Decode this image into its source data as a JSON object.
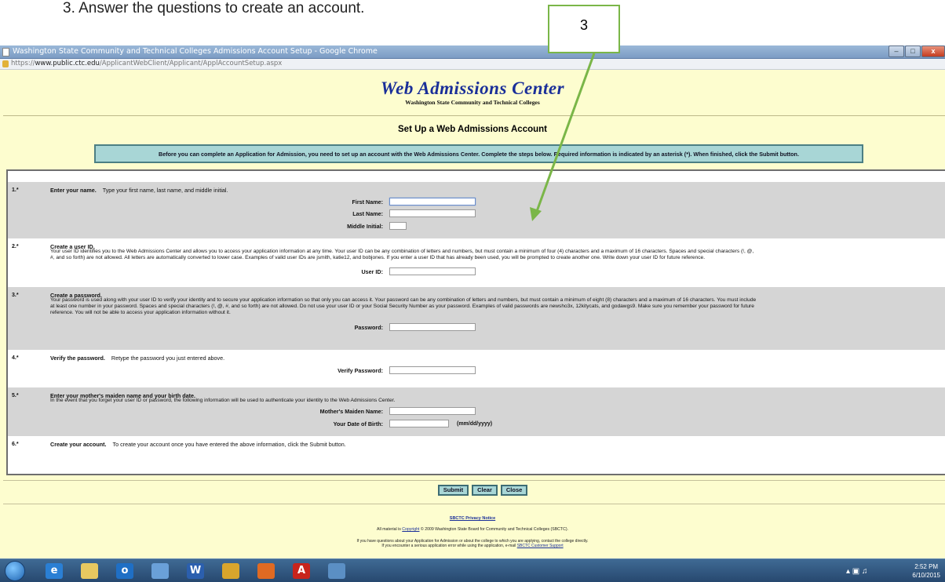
{
  "document": {
    "step_text": "3.   Answer the questions to create an account.",
    "callout": "3"
  },
  "browser": {
    "window_title": "Washington State Community and Technical Colleges Admissions Account Setup - Google Chrome",
    "url_prefix": "https://",
    "url_host": "www.public.ctc.edu",
    "url_path": "/ApplicantWebClient/Applicant/ApplAccountSetup.aspx",
    "controls": [
      "–",
      "□",
      "x"
    ]
  },
  "page": {
    "brand": "Web Admissions Center",
    "subbrand": "Washington State Community and Technical Colleges",
    "title": "Set Up a Web Admissions Account",
    "notice": "Before you can complete an Application for Admission, you need to set up an account with the Web Admissions Center. Complete the steps below. Required information is indicated by an asterisk (*). When finished, click the Submit button."
  },
  "steps": [
    {
      "num": "1.*",
      "heading": "Enter your name.",
      "desc_inline": "Type your first name, last name, and middle initial.",
      "fields": [
        "First Name:",
        "Last Name:",
        "Middle Initial:"
      ]
    },
    {
      "num": "2.*",
      "heading": "Create a user ID.",
      "desc_line1": "Your user ID identifies you to the Web Admissions Center and allows you to access your application information at any time. Your user ID can be any combination of letters and numbers, but must contain a minimum of four (4) characters and a maximum of 16 characters. Spaces and special characters (!, @,",
      "desc_line2": "#, and so forth) are not allowed. All letters are automatically converted to lower case. Examples of valid user IDs are jsmith, katie12, and bobjones. If you enter a user ID that has already been used, you will be prompted to create another one. Write down your user ID for future reference.",
      "fields": [
        "User ID:"
      ]
    },
    {
      "num": "3.*",
      "heading": "Create a password.",
      "desc_line1": "Your password is used along with your user ID to verify your identity and to secure your application information so that only you can access it. Your password can be any combination of letters and numbers, but must contain a minimum of eight (8) characters and a maximum of 16 characters. You must include",
      "desc_line2": "at least one number in your password. Spaces and special characters (!, @, #, and so forth) are not allowed. Do not use your user ID or your Social Security Number as your password. Examples of valid passwords are newsho3x, 12kitycats, and godawgs9. Make sure you remember your password for future",
      "desc_line3": "reference. You will not be able to access your application information without it.",
      "fields": [
        "Password:"
      ]
    },
    {
      "num": "4.*",
      "heading": "Verify the password.",
      "desc_inline": "Retype the password you just entered above.",
      "fields": [
        "Verify Password:"
      ]
    },
    {
      "num": "5.*",
      "heading": "Enter your mother's maiden name and your birth date.",
      "desc_line1": "In the event that you forget your user ID or password, the following information will be used to authenticate your identity to the Web Admissions Center.",
      "fields": [
        "Mother's Maiden Name:",
        "Your Date of Birth:"
      ],
      "date_format": "(mm/dd/yyyy)"
    },
    {
      "num": "6.*",
      "heading": "Create your account.",
      "desc_inline": "To create your account once you have entered the above information, click the Submit button."
    }
  ],
  "buttons": [
    "Submit",
    "Clear",
    "Close"
  ],
  "footer": {
    "privacy": "SBCTC Privacy Notice",
    "copyright_pre": "All material is ",
    "copyright_link": "Copyright",
    "copyright_post": " © 2009 Washington State Board for Community and Technical Colleges (SBCTC).",
    "contact_line1": "If you have questions about your Application for Admission or about the college to which you are applying, contact the college directly.",
    "contact_line2_pre": "If you encounter a serious application error while using the application, e-mail ",
    "contact_link": "SBCTC Customer Support"
  },
  "taskbar": {
    "apps": [
      {
        "name": "internet-explorer",
        "glyph": "e",
        "color": "#2a7fd4"
      },
      {
        "name": "file-explorer",
        "glyph": "",
        "color": "#e8c860"
      },
      {
        "name": "outlook",
        "glyph": "o",
        "color": "#1f6fc5"
      },
      {
        "name": "notes",
        "glyph": "",
        "color": "#6aa0d8"
      },
      {
        "name": "word",
        "glyph": "W",
        "color": "#2b5fae"
      },
      {
        "name": "chrome",
        "glyph": "",
        "color": "#d9a52c"
      },
      {
        "name": "firefox",
        "glyph": "",
        "color": "#e06a22"
      },
      {
        "name": "acrobat",
        "glyph": "A",
        "color": "#c8241c"
      },
      {
        "name": "remote-desktop",
        "glyph": "",
        "color": "#5b8fc4"
      }
    ],
    "time": "2:52 PM",
    "date": "6/10/2015"
  }
}
